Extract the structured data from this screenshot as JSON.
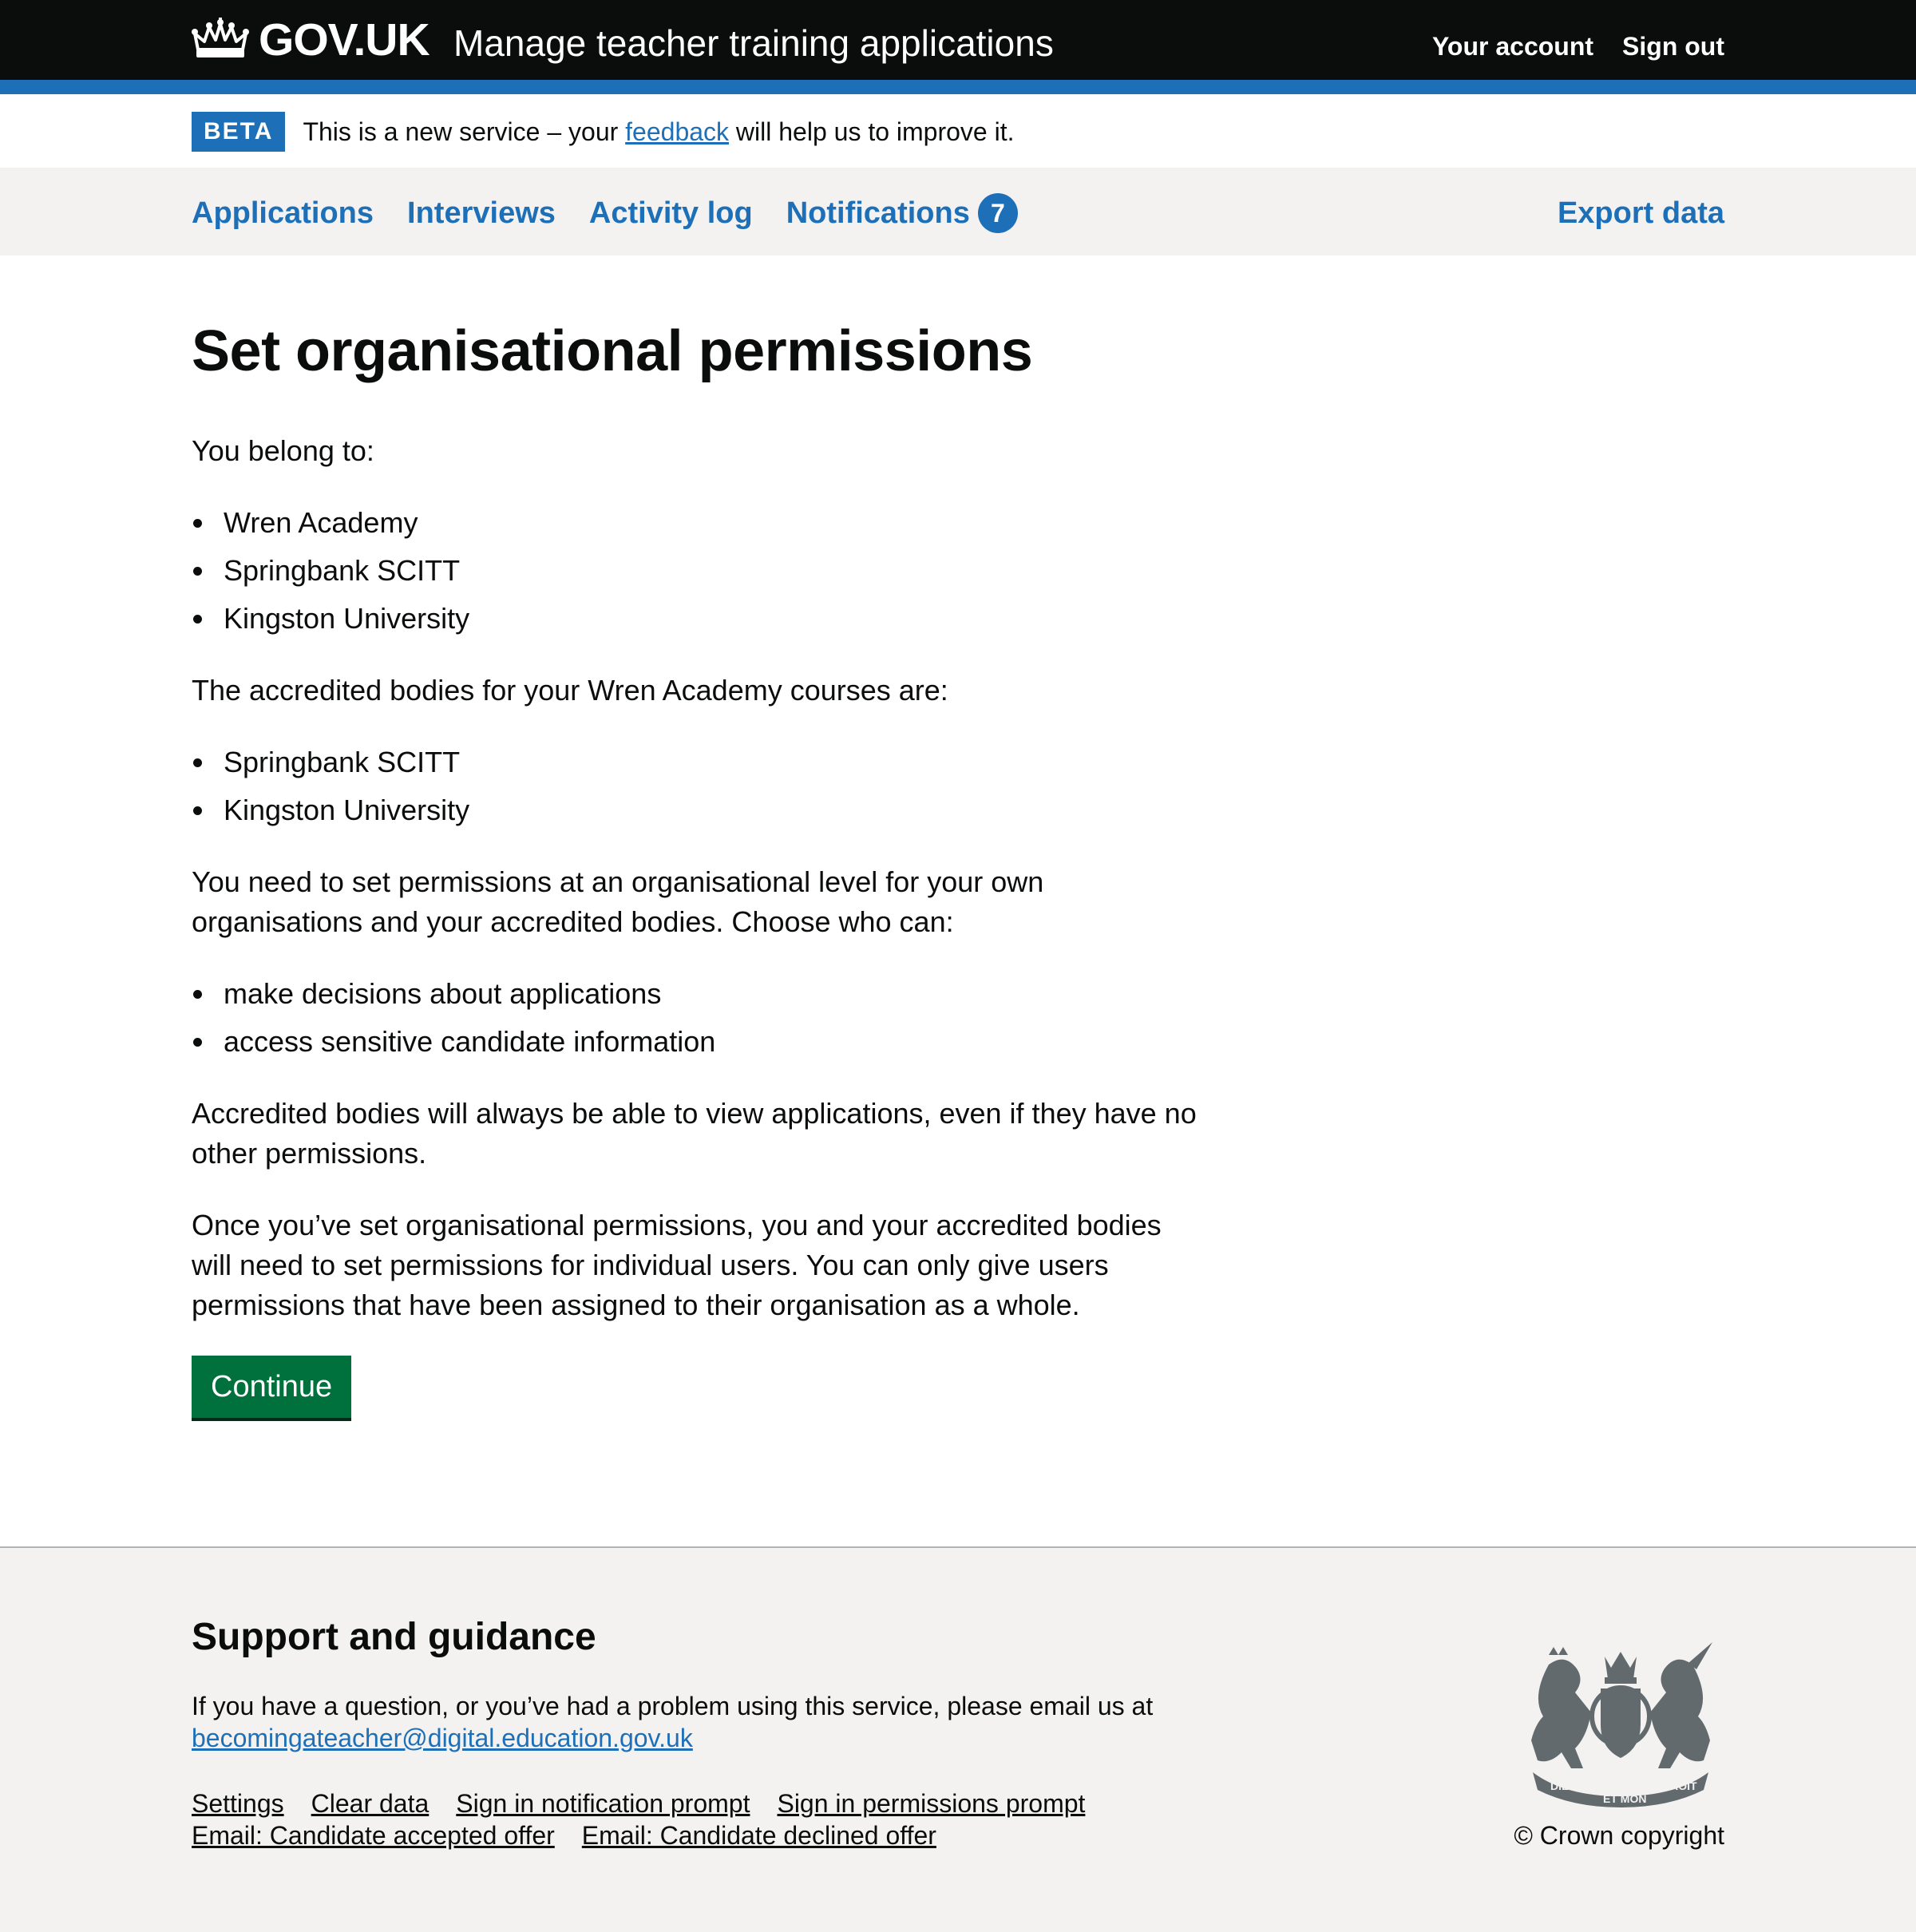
{
  "header": {
    "logo_text": "GOV.UK",
    "service_name": "Manage teacher training applications",
    "links": [
      "Your account",
      "Sign out"
    ]
  },
  "beta": {
    "tag": "BETA",
    "text_before": "This is a new service – your ",
    "link": "feedback",
    "text_after": " will help us to improve it."
  },
  "nav": {
    "items": [
      "Applications",
      "Interviews",
      "Activity log",
      "Notifications"
    ],
    "notifications_count": "7",
    "export": "Export data"
  },
  "main": {
    "title": "Set organisational permissions",
    "belong_intro": "You belong to:",
    "organisations": [
      "Wren Academy",
      "Springbank SCITT",
      "Kingston University"
    ],
    "accredited_intro": "The accredited bodies for your Wren Academy courses are:",
    "accredited_bodies": [
      "Springbank SCITT",
      "Kingston University"
    ],
    "permissions_intro": "You need to set permissions at an organisational level for your own organisations and your accredited bodies. Choose who can:",
    "permissions": [
      "make decisions about applications",
      "access sensitive candidate information"
    ],
    "view_note": "Accredited bodies will always be able to view applications, even if they have no other permissions.",
    "individual_note": "Once you’ve set organisational permissions, you and your accredited bodies will need to set permissions for individual users. You can only give users permissions that have been assigned to their organisation as a whole.",
    "continue_label": "Continue"
  },
  "footer": {
    "heading": "Support and guidance",
    "help_text": "If you have a question, or you’ve had a problem using this service, please email us at",
    "email": "becomingateacher@digital.education.gov.uk",
    "links": [
      "Settings",
      "Clear data",
      "Sign in notification prompt",
      "Sign in permissions prompt",
      "Email: Candidate accepted offer",
      "Email: Candidate declined offer"
    ],
    "copyright": "© Crown copyright",
    "crest_text": [
      "DIEU",
      "ET MON",
      "DROIT"
    ]
  },
  "colors": {
    "header_bg": "#0b0c0c",
    "brand_blue": "#1d70b8",
    "button_green": "#00703c",
    "footer_bg": "#f3f2f1"
  }
}
